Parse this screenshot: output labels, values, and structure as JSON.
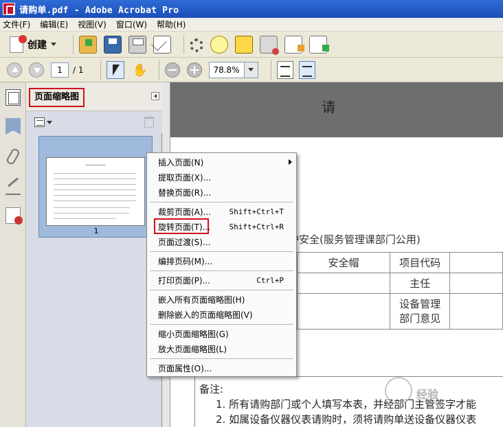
{
  "window": {
    "title": "请购单.pdf - Adobe Acrobat Pro"
  },
  "menubar": {
    "items": [
      {
        "label": "文件(F)"
      },
      {
        "label": "编辑(E)"
      },
      {
        "label": "视图(V)"
      },
      {
        "label": "窗口(W)"
      },
      {
        "label": "帮助(H)"
      }
    ]
  },
  "toolbar": {
    "create_label": "创建",
    "icons": [
      "open-icon",
      "save-icon",
      "print-icon",
      "email-icon",
      "settings-icon",
      "comment-icon",
      "sign-icon",
      "secure-icon",
      "forms-icon",
      "export-icon"
    ]
  },
  "nav": {
    "current_page": "1",
    "page_total": "/ 1",
    "zoom": "78.8%"
  },
  "sidebar": {
    "icons": [
      "page-thumbnails-icon",
      "bookmarks-icon",
      "attachments-icon",
      "signatures-icon",
      "security-icon"
    ]
  },
  "panel": {
    "title": "页面缩略图",
    "thumbnail_page_number": "1"
  },
  "context_menu": {
    "items": [
      {
        "label": "插入页面(N)",
        "shortcut": "",
        "submenu": true
      },
      {
        "label": "提取页面(X)...",
        "shortcut": ""
      },
      {
        "label": "替换页面(R)...",
        "shortcut": ""
      },
      {
        "label": "裁剪页面(A)...",
        "shortcut": "Shift+Ctrl+T"
      },
      {
        "label": "旋转页面(T)...",
        "shortcut": "Shift+Ctrl+R"
      },
      {
        "label": "页面过渡(S)...",
        "shortcut": ""
      },
      {
        "label": "编排页码(M)...",
        "shortcut": ""
      },
      {
        "label": "打印页面(P)...",
        "shortcut": "Ctrl+P"
      },
      {
        "label": "嵌入所有页面缩略图(H)",
        "shortcut": ""
      },
      {
        "label": "删除嵌入的页面缩略图(V)",
        "shortcut": ""
      },
      {
        "label": "缩小页面缩略图(G)",
        "shortcut": ""
      },
      {
        "label": "放大页面缩略图(L)",
        "shortcut": ""
      },
      {
        "label": "页面属性(O)...",
        "shortcut": ""
      }
    ]
  },
  "document": {
    "title_fragment": "请",
    "subtitle_fragment": "护安全(服务管理课部门公用)",
    "table": {
      "item_name": "安全帽",
      "code_label": "项目代码",
      "supervisor_label": "主任",
      "equipment_label_1": "设备管理",
      "equipment_label_2": "部门意见"
    },
    "remarks_title": "备注:",
    "remark_1": "1. 所有请购部门或个人填写本表，并经部门主管签字才能",
    "remark_2": "2. 如属设备仪器仪表请购时，须将请购单送设备仪器仪表"
  },
  "watermark": {
    "text": "经验"
  },
  "colors": {
    "highlight": "#d0101a",
    "titlebar": "#1b4fb8"
  }
}
